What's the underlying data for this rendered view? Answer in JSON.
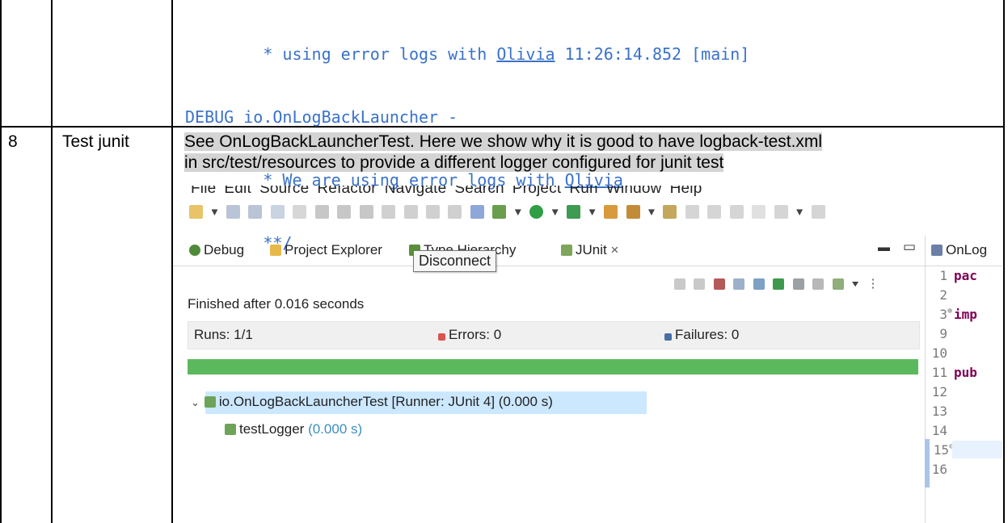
{
  "code_block": {
    "line1_pre": "        * using error logs with ",
    "line1_link": "Olivia",
    "line1_post": " 11:26:14.852 [main]",
    "line2": "DEBUG io.OnLogBackLauncher -",
    "line3_pre": "        * We are using error logs with ",
    "line3_link": "Olivia",
    "line4": "        **/"
  },
  "row": {
    "number": "8",
    "title": "Test junit",
    "desc_line1": "See OnLogBackLauncherTest. Here we show why it is good to have logback-test.xml",
    "desc_line2": "in src/test/resources to provide a different logger configured for junit test"
  },
  "eclipse": {
    "menu": [
      "File",
      "Edit",
      "Source",
      "Refactor",
      "Navigate",
      "Search",
      "Project",
      "Run",
      "Window",
      "Help"
    ],
    "tabs": {
      "debug": "Debug",
      "project_explorer": "Project Explorer",
      "type_hierarchy": "Type Hierarchy",
      "junit": "JUnit",
      "editor": "OnLog"
    },
    "tooltip": "Disconnect",
    "status": "Finished after 0.016 seconds",
    "runs_label": "Runs:",
    "runs_value": "1/1",
    "errors_label": "Errors:",
    "errors_value": "0",
    "failures_label": "Failures:",
    "failures_value": "0",
    "progress": 1.0,
    "progress_color": "#5cb85c",
    "tree_root": "io.OnLogBackLauncherTest [Runner: JUnit 4] (0.000 s)",
    "tree_child": "testLogger",
    "tree_child_time": "(0.000 s)",
    "line_numbers": [
      "1",
      "2",
      "3",
      "9",
      "10",
      "11",
      "12",
      "13",
      "14",
      "15",
      "16"
    ],
    "code_kw": {
      "l1": "pac",
      "l3": "imp",
      "l11": "pub"
    }
  }
}
